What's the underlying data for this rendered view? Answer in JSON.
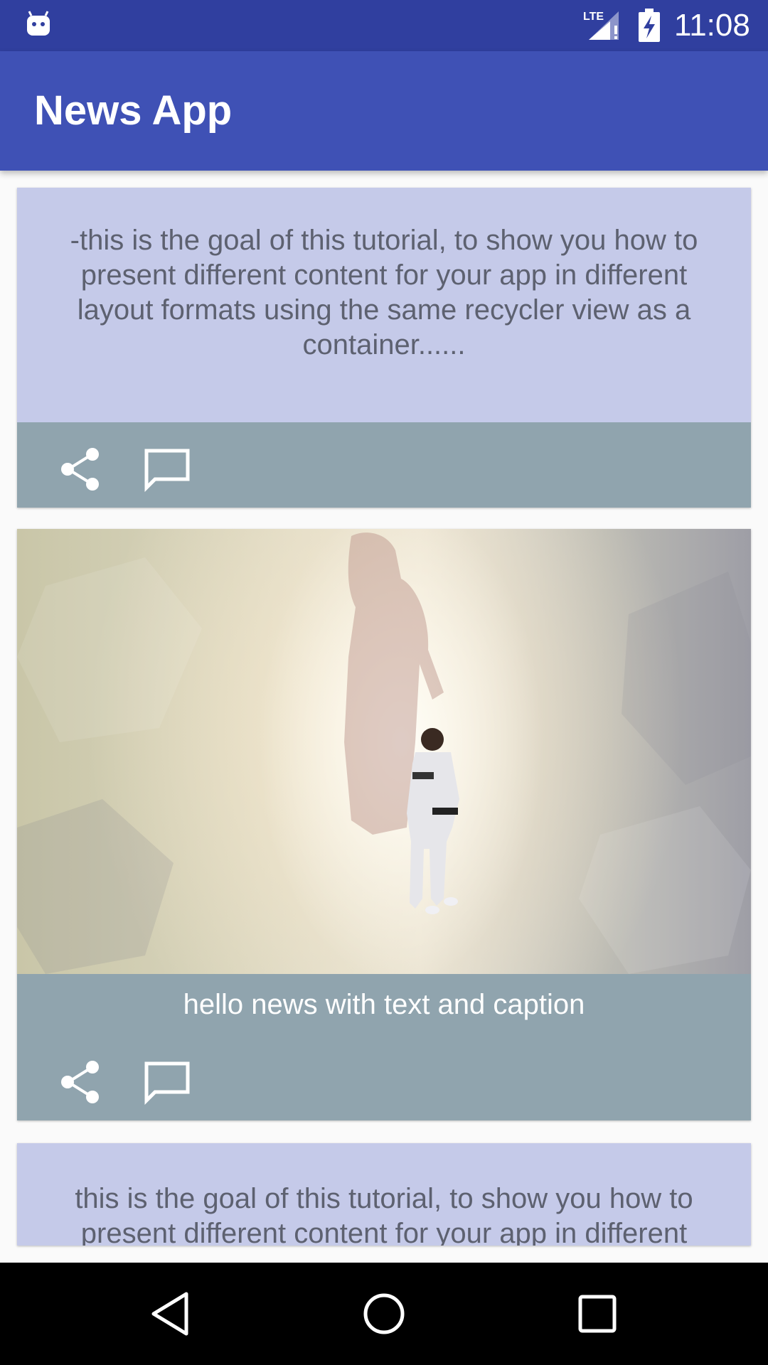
{
  "status_bar": {
    "time": "11:08",
    "network_label": "LTE",
    "icons": [
      "notification-android-icon",
      "lte-signal-icon",
      "battery-charging-icon"
    ]
  },
  "app_bar": {
    "title": "News App"
  },
  "feed": {
    "cards": [
      {
        "type": "text",
        "text": "-this is the goal of this tutorial, to show you how to present different content for your app in different layout formats using the same recycler view as a container......",
        "actions": [
          "share-icon",
          "comment-icon"
        ]
      },
      {
        "type": "image",
        "caption": "hello news with text and caption",
        "actions": [
          "share-icon",
          "comment-icon"
        ]
      },
      {
        "type": "text",
        "text": "this is the goal of this tutorial, to show you how to present different content for your app in different",
        "actions": []
      }
    ]
  },
  "nav_bar": {
    "buttons": [
      "back-icon",
      "home-icon",
      "recents-icon"
    ]
  },
  "colors": {
    "status_bar": "#303f9f",
    "app_bar": "#3f51b5",
    "card_text_bg": "#c5cae9",
    "card_actions_bg": "#90a4ae",
    "nav_bar": "#000000"
  }
}
